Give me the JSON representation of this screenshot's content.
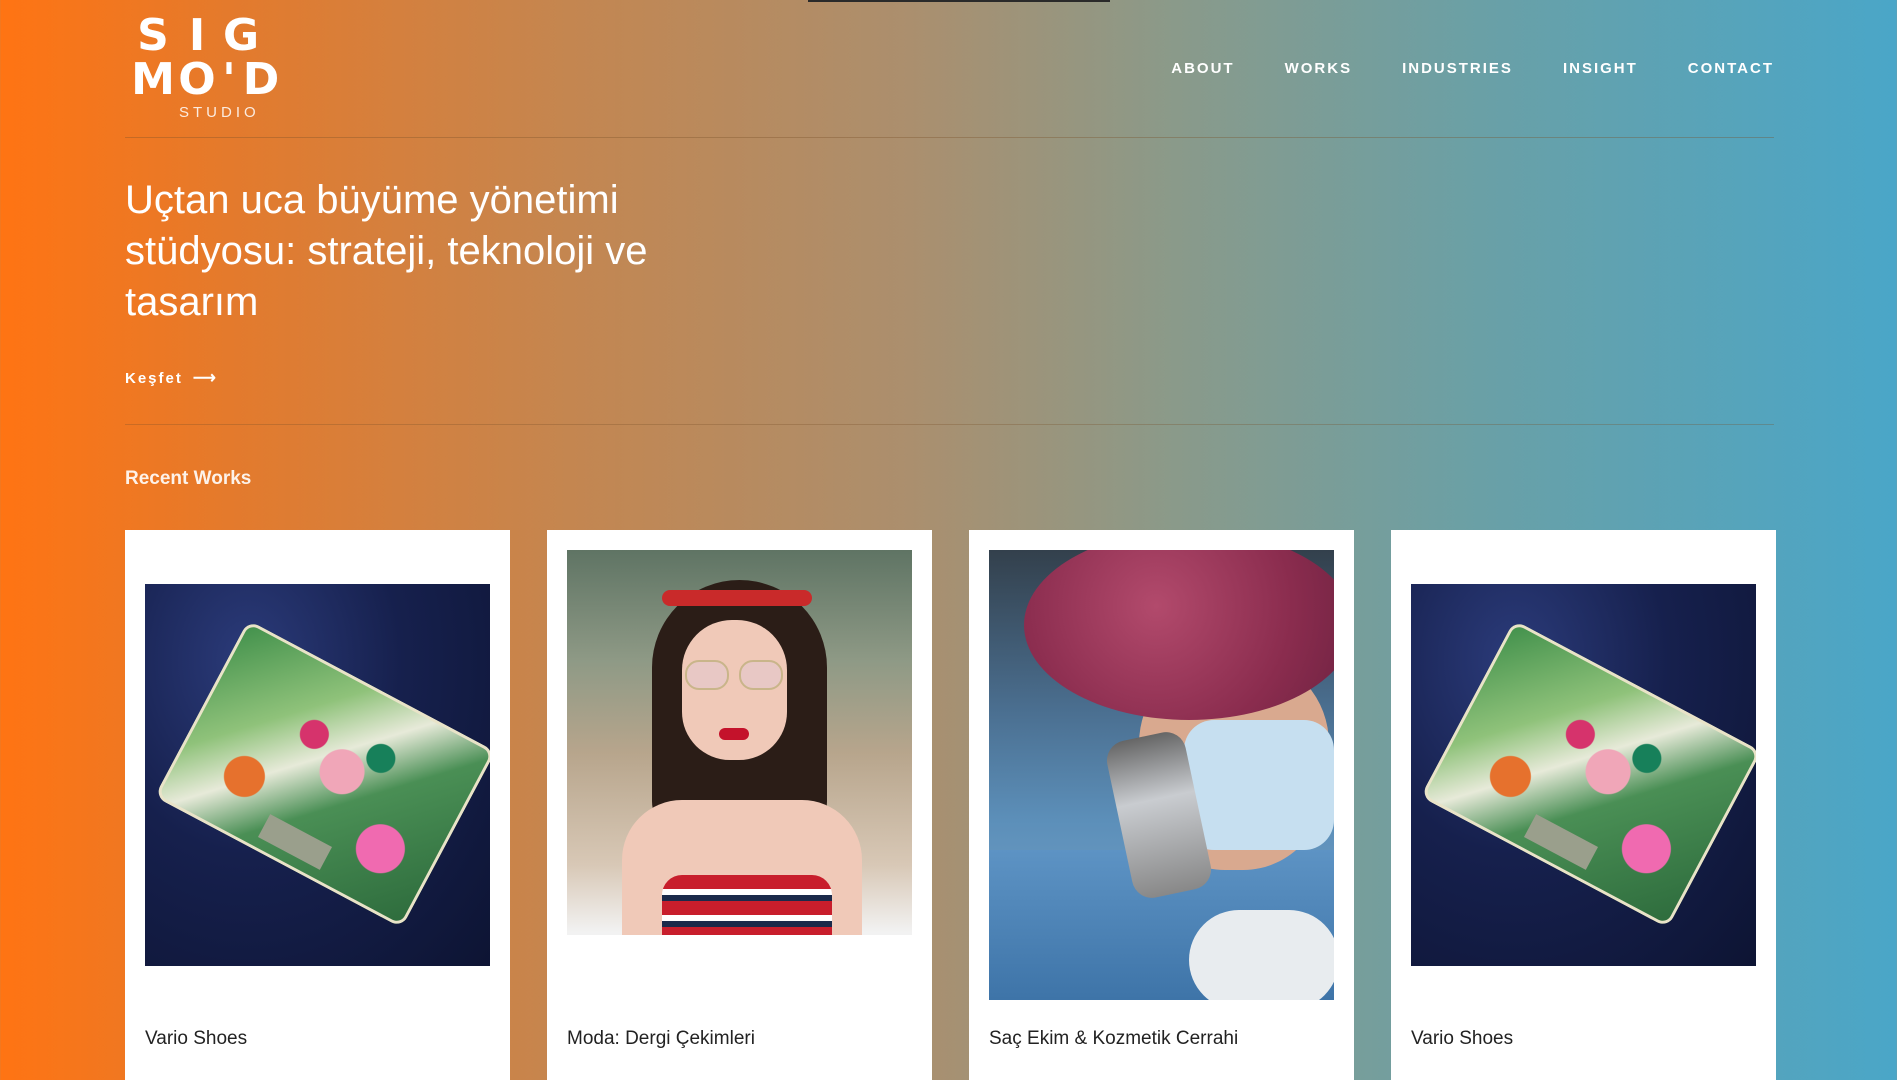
{
  "brand": {
    "logo_row1": [
      "S",
      "I",
      "G"
    ],
    "logo_row2": [
      "M",
      "O",
      "'",
      "D"
    ],
    "logo_sub": "STUDIO"
  },
  "nav": {
    "items": [
      "ABOUT",
      "WORKS",
      "INDUSTRIES",
      "INSIGHT",
      "CONTACT"
    ]
  },
  "hero": {
    "title": "Uçtan uca büyüme yönetimi stüdyosu: strateji, teknoloji ve tasarım",
    "cta_label": "Keşfet",
    "cta_icon": "arrow-right-icon"
  },
  "recent": {
    "title": "Recent Works",
    "cards": [
      {
        "caption": "Vario Shoes",
        "image": "floral-bag-photo"
      },
      {
        "caption": "Moda: Dergi Çekimleri",
        "image": "fashion-portrait-photo"
      },
      {
        "caption": "Saç Ekim & Kozmetik Cerrahi",
        "image": "surgeon-photo"
      },
      {
        "caption": "Vario Shoes",
        "image": "floral-bag-photo"
      }
    ]
  },
  "colors": {
    "gradient_start": "#ff7413",
    "gradient_end": "#4aa6c8",
    "card_bg": "#ffffff",
    "text": "#ffffff"
  }
}
